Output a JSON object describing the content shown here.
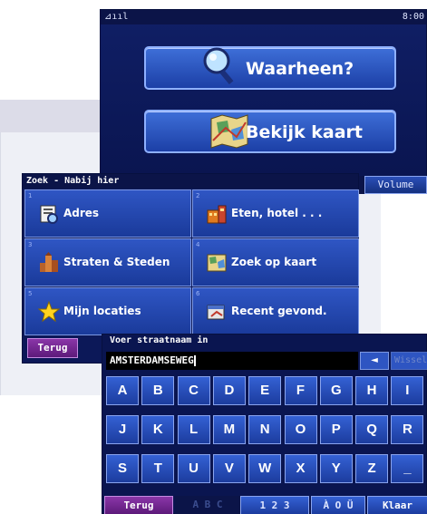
{
  "main_menu": {
    "status": {
      "signal": "⊿ııl",
      "clock": "8:00"
    },
    "where_to_label": "Waarheen?",
    "view_map_label": "Bekijk kaart",
    "volume_label": "Volume"
  },
  "search_menu": {
    "title": "Zoek - Nabij hier",
    "items": [
      {
        "num": "1",
        "label": "Adres",
        "icon": "address-book-icon"
      },
      {
        "num": "2",
        "label": "Eten, hotel . . .",
        "icon": "food-hotel-icon"
      },
      {
        "num": "3",
        "label": "Straten & Steden",
        "icon": "city-icon"
      },
      {
        "num": "4",
        "label": "Zoek op kaart",
        "icon": "map-search-icon"
      },
      {
        "num": "5",
        "label": "Mijn locaties",
        "icon": "star-icon"
      },
      {
        "num": "6",
        "label": "Recent gevond.",
        "icon": "recent-icon"
      }
    ],
    "back_label": "Terug"
  },
  "keyboard": {
    "title": "Voer straatnaam in",
    "input_value": "AMSTERDAMSEWEG",
    "backspace_label": "◄",
    "switch_label": "Wissel",
    "rows": [
      [
        "A",
        "B",
        "C",
        "D",
        "E",
        "F",
        "G",
        "H",
        "I"
      ],
      [
        "J",
        "K",
        "L",
        "M",
        "N",
        "O",
        "P",
        "Q",
        "R"
      ],
      [
        "S",
        "T",
        "U",
        "V",
        "W",
        "X",
        "Y",
        "Z",
        "_"
      ]
    ],
    "back_label": "Terug",
    "mode_abc": "A B C",
    "mode_123": "1 2 3",
    "mode_accent": "À O Ü",
    "done_label": "Klaar"
  },
  "colors": {
    "screen_bg": "#0c1858",
    "button_blue": "#2f56c4",
    "back_purple": "#8a36a8"
  }
}
